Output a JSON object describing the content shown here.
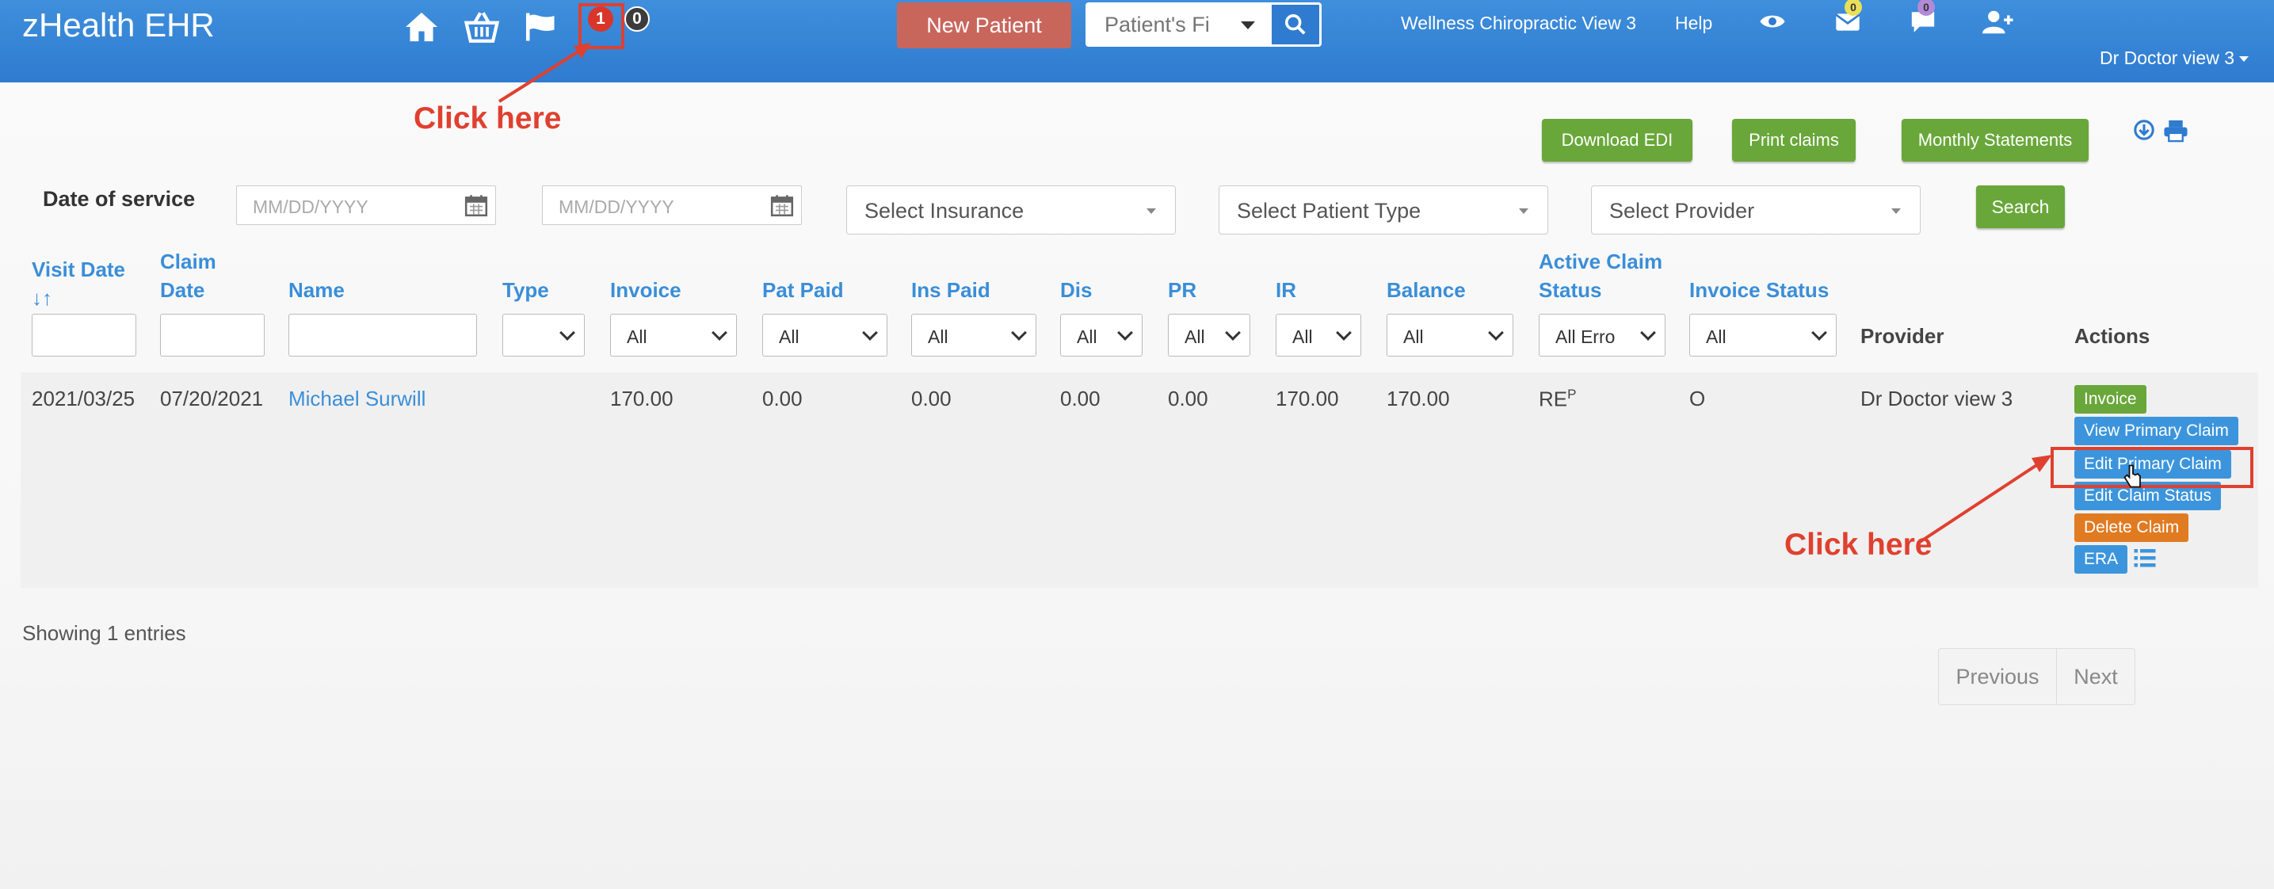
{
  "header": {
    "brand": "zHealth EHR",
    "notif_red_count": "1",
    "notif_dark_count": "0",
    "new_patient": "New Patient",
    "search_placeholder": "Patient's Fi",
    "practice": "Wellness Chiropractic View 3",
    "help": "Help",
    "mail_badge": "0",
    "chat_badge": "0",
    "user": "Dr Doctor view 3"
  },
  "annotations": {
    "callout_top": "Click here",
    "callout_right": "Click here"
  },
  "toolbar": {
    "download_edi": "Download EDI",
    "print_claims": "Print claims",
    "monthly_statements": "Monthly Statements"
  },
  "filters": {
    "date_label": "Date of service",
    "date_from_placeholder": "MM/DD/YYYY",
    "date_to_placeholder": "MM/DD/YYYY",
    "insurance": "Select Insurance",
    "patient_type": "Select Patient Type",
    "provider": "Select Provider",
    "search": "Search"
  },
  "table": {
    "headers": {
      "visit_date": "Visit Date",
      "sort_glyph": "↓↑",
      "claim_date_1": "Claim",
      "claim_date_2": "Date",
      "name": "Name",
      "type": "Type",
      "invoice": "Invoice",
      "pat_paid": "Pat Paid",
      "ins_paid": "Ins Paid",
      "dis": "Dis",
      "pr": "PR",
      "ir": "IR",
      "balance": "Balance",
      "active_claim_1": "Active Claim",
      "active_claim_2": "Status",
      "invoice_status": "Invoice Status",
      "provider": "Provider",
      "actions": "Actions"
    },
    "filter_values": {
      "invoice": "All",
      "pat_paid": "All",
      "ins_paid": "All",
      "dis": "All",
      "pr": "All",
      "ir": "All",
      "balance": "All",
      "active_claim": "All Erro",
      "invoice_status": "All"
    },
    "row": {
      "visit_date": "2021/03/25",
      "claim_date": "07/20/2021",
      "name": "Michael Surwill",
      "invoice": "170.00",
      "pat_paid": "0.00",
      "ins_paid": "0.00",
      "dis": "0.00",
      "pr": "0.00",
      "ir": "170.00",
      "balance": "170.00",
      "claim_status": "RE",
      "claim_status_sup": "P",
      "invoice_status": "O",
      "provider": "Dr Doctor view 3"
    },
    "actions": {
      "invoice": "Invoice",
      "view_primary": "View Primary Claim",
      "edit_primary": "Edit Primary Claim",
      "edit_status": "Edit Claim Status",
      "delete": "Delete Claim",
      "era": "ERA"
    }
  },
  "footer": {
    "showing": "Showing 1 entries",
    "previous": "Previous",
    "next": "Next"
  },
  "colors": {
    "header_blue": "#2f7bd0",
    "link_blue": "#3a8ed8",
    "button_green": "#69a73a",
    "delete_orange": "#e07b22",
    "annotation_red": "#e0402f"
  }
}
